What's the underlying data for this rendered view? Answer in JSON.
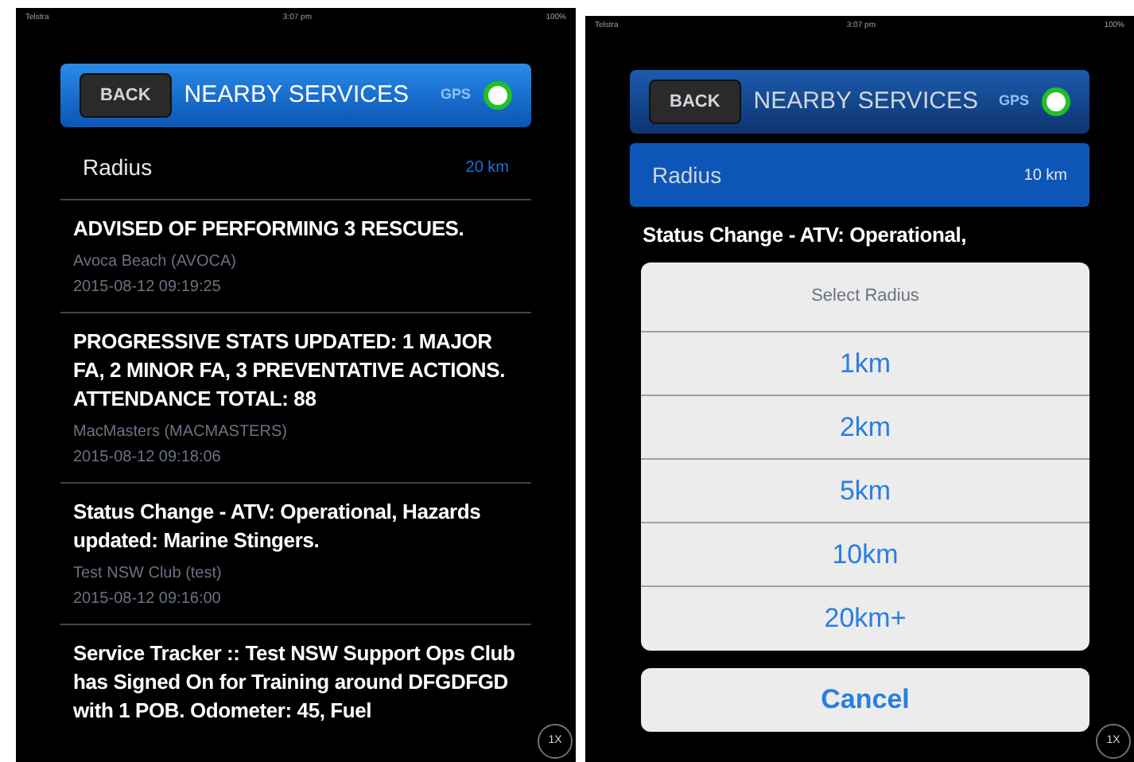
{
  "screens": [
    {
      "status_bar": {
        "carrier": "Telstra",
        "time": "3:07 pm",
        "battery": "100%"
      },
      "header": {
        "back": "BACK",
        "title": "NEARBY SERVICES",
        "gps_label": "GPS",
        "gps_on": true
      },
      "radius": {
        "label": "Radius",
        "value": "20 km",
        "selected": false
      },
      "items": [
        {
          "title": "ADVISED OF PERFORMING 3 RESCUES.",
          "club": "Avoca Beach (AVOCA)",
          "time": "2015-08-12 09:19:25"
        },
        {
          "title": "PROGRESSIVE STATS UPDATED: 1 MAJOR FA, 2 MINOR FA, 3 PREVENTATIVE ACTIONS. ATTENDANCE TOTAL: 88",
          "club": "MacMasters (MACMASTERS)",
          "time": "2015-08-12 09:18:06"
        },
        {
          "title": "Status Change - ATV: Operational, Hazards updated: Marine Stingers.",
          "club": "Test NSW Club (test)",
          "time": "2015-08-12 09:16:00"
        },
        {
          "title": "Service Tracker :: Test NSW Support Ops Club has Signed On for Training around DFGDFGD with 1 POB. Odometer: 45, Fuel"
        }
      ],
      "zoom_badge": "1X"
    },
    {
      "status_bar": {
        "carrier": "Telstra",
        "time": "3:07 pm",
        "battery": "100%"
      },
      "header": {
        "back": "BACK",
        "title": "NEARBY SERVICES",
        "gps_label": "GPS",
        "gps_on": true
      },
      "radius": {
        "label": "Radius",
        "value": "10 km",
        "selected": true
      },
      "items": [
        {
          "title": "Status Change - ATV: Operational,"
        }
      ],
      "zoom_badge": "1X",
      "action_sheet": {
        "title": "Select Radius",
        "options": [
          {
            "label": "1km"
          },
          {
            "label": "2km"
          },
          {
            "label": "5km"
          },
          {
            "label": "10km"
          },
          {
            "label": "20km+"
          }
        ],
        "cancel": "Cancel"
      }
    }
  ]
}
